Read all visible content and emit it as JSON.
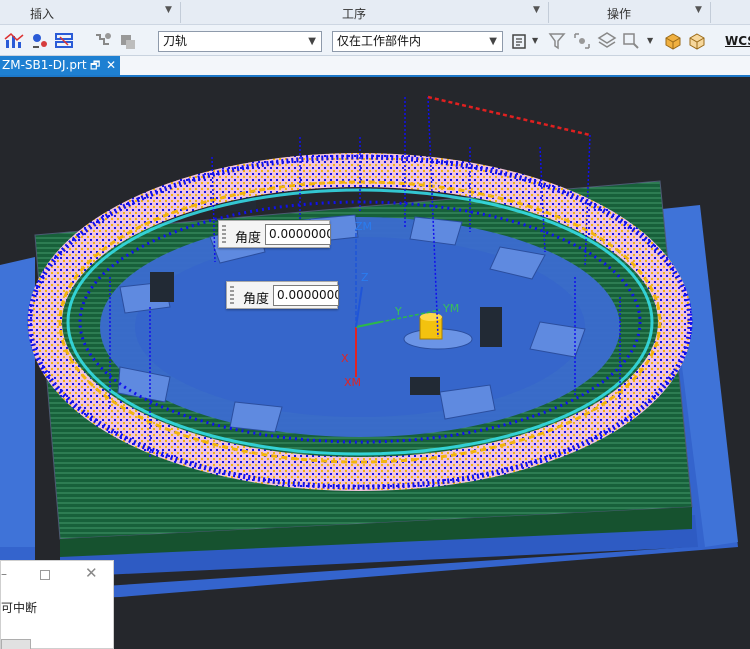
{
  "ribbon": {
    "groups": {
      "insert": "插入",
      "operation": "工序",
      "action": "操作"
    },
    "type_filter": {
      "value": "刀轨"
    },
    "scope_filter": {
      "value": "仅在工作部件内"
    },
    "wcs_label": "WCS"
  },
  "document_tab": {
    "title": "ZM-SB1-DJ.prt",
    "close_glyph": "✕"
  },
  "viewport": {
    "angle_inputs": [
      {
        "label": "角度",
        "value": "0.0000000"
      },
      {
        "label": "角度",
        "value": "0.0000000"
      }
    ],
    "axis_labels": {
      "zm": "ZM",
      "z": "Z",
      "y": "Y",
      "ym": "YM",
      "x": "X",
      "xm": "XM"
    }
  },
  "dialog": {
    "message": "可中断"
  },
  "colors": {
    "viewport_background": "#25272c",
    "fixture_blue": "#3d6fd1",
    "base_green": "#1e6a3a",
    "toolpath_blue": "#1010ee",
    "toolpath_cyan": "#36e3ee",
    "toolpath_orange": "#f2b40f",
    "toolpath_pink": "#f0c4dc",
    "cutter_yellow": "#f3c20f",
    "accent_tab": "#1e80d2"
  }
}
